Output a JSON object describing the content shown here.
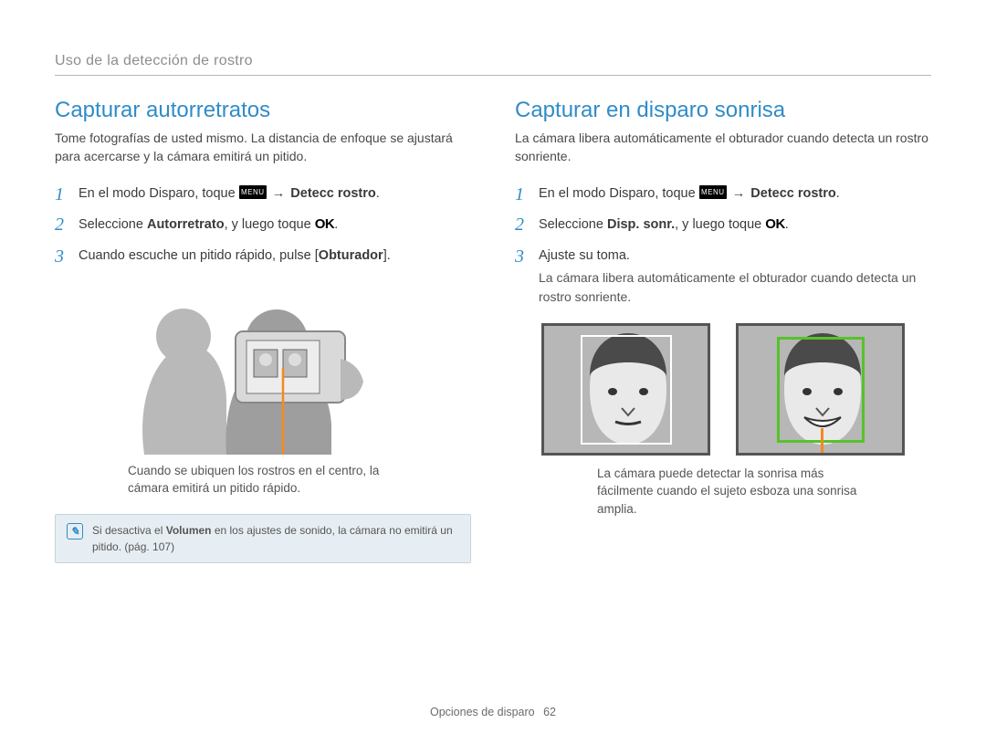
{
  "breadcrumb": "Uso de la detección de rostro",
  "icons": {
    "menu": "MENU",
    "ok": "OK",
    "note_glyph": "✎"
  },
  "arrows": {
    "right": "→"
  },
  "left": {
    "heading": "Capturar autorretratos",
    "lead": "Tome fotografías de usted mismo. La distancia de enfoque se ajustará para acercarse y la cámara emitirá un pitido.",
    "steps": [
      {
        "pre": "En el modo Disparo, toque ",
        "post_bold": "Detecc rostro",
        "suffix": "."
      },
      {
        "pre": "Seleccione ",
        "bold": "Autorretrato",
        "mid": ", y luego toque ",
        "suffix": "."
      },
      {
        "pre": "Cuando escuche un pitido rápido, pulse [",
        "bold": "Obturador",
        "suffix": "]."
      }
    ],
    "caption": "Cuando se ubiquen los rostros en el centro, la cámara emitirá un pitido rápido.",
    "note_pre": "Si desactiva el ",
    "note_bold": "Volumen",
    "note_post": " en los ajustes de sonido, la cámara no emitirá un pitido. (pág. 107)"
  },
  "right": {
    "heading": "Capturar en disparo sonrisa",
    "lead": "La cámara libera automáticamente el obturador cuando detecta un rostro sonriente.",
    "steps": [
      {
        "pre": "En el modo Disparo, toque ",
        "post_bold": "Detecc rostro",
        "suffix": "."
      },
      {
        "pre": "Seleccione ",
        "bold": "Disp. sonr.",
        "mid": ", y luego toque ",
        "suffix": "."
      },
      {
        "pre": "Ajuste su toma.",
        "sub": "La cámara libera automáticamente el obturador cuando detecta un rostro sonriente."
      }
    ],
    "caption": "La cámara puede detectar la sonrisa más fácilmente cuando el sujeto esboza una sonrisa amplia."
  },
  "footer": {
    "section": "Opciones de disparo",
    "page": "62"
  }
}
